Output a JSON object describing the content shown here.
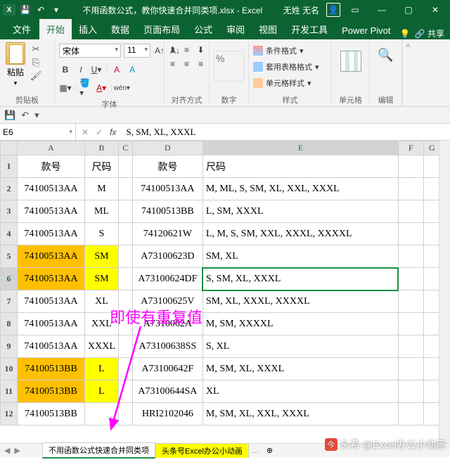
{
  "title": "不用函数公式，教你快速合并同类项.xlsx  -  Excel",
  "user": "无姓 无名",
  "tabs": {
    "file": "文件",
    "home": "开始",
    "insert": "插入",
    "data": "数据",
    "layout": "页面布局",
    "formulas": "公式",
    "review": "审阅",
    "view": "视图",
    "dev": "开发工具",
    "power": "Power Pivot"
  },
  "share": "共享",
  "ribbon": {
    "clipboard": {
      "paste": "粘贴",
      "label": "剪贴板"
    },
    "font": {
      "name": "宋体",
      "size": "11",
      "label": "字体"
    },
    "align": {
      "btn": "对齐方式",
      "label": ""
    },
    "number": {
      "btn": "数字",
      "label": ""
    },
    "styles": {
      "cond": "条件格式",
      "table": "套用表格格式",
      "cell": "单元格样式",
      "label": "样式"
    },
    "cells": {
      "btn": "单元格"
    },
    "edit": {
      "btn": "编辑"
    }
  },
  "namebox": "E6",
  "formula": "S, SM, XL, XXXL",
  "columns": {
    "A": "A",
    "B": "B",
    "C": "C",
    "D": "D",
    "E": "E",
    "F": "F",
    "G": "G"
  },
  "colwidths": {
    "A": 96,
    "B": 46,
    "C": 20,
    "D": 100,
    "E": 278,
    "F": 36,
    "G": 24
  },
  "headers": {
    "A": "款号",
    "B": "尺码",
    "D": "款号",
    "E": "尺码"
  },
  "rows": [
    {
      "n": 1
    },
    {
      "n": 2,
      "A": "74100513AA",
      "B": "M",
      "D": "74100513AA",
      "E": "M, ML, S, SM, XL, XXL, XXXL"
    },
    {
      "n": 3,
      "A": "74100513AA",
      "B": "ML",
      "D": "74100513BB",
      "E": "L, SM, XXXL"
    },
    {
      "n": 4,
      "A": "74100513AA",
      "B": "S",
      "D": "74120621W",
      "E": "L, M, S, SM, XXL, XXXL, XXXXL"
    },
    {
      "n": 5,
      "A": "74100513AA",
      "B": "SM",
      "D": "A73100623D",
      "E": "SM, XL",
      "hlA": "orange",
      "hlB": "yellow"
    },
    {
      "n": 6,
      "A": "74100513AA",
      "B": "SM",
      "D": "A73100624DF",
      "E": "S, SM, XL, XXXL",
      "hlA": "orange",
      "hlB": "yellow",
      "sel": true
    },
    {
      "n": 7,
      "A": "74100513AA",
      "B": "XL",
      "D": "A73100625V",
      "E": "SM, XL, XXXL, XXXXL"
    },
    {
      "n": 8,
      "A": "74100513AA",
      "B": "XXL",
      "D": "A7310062A",
      "E": "M, SM, XXXXL"
    },
    {
      "n": 9,
      "A": "74100513AA",
      "B": "XXXL",
      "D": "A73100638SS",
      "E": "S, XL"
    },
    {
      "n": 10,
      "A": "74100513BB",
      "B": "L",
      "D": "A73100642F",
      "E": "M, SM, XL, XXXL",
      "hlA": "orange",
      "hlB": "yellow"
    },
    {
      "n": 11,
      "A": "74100513BB",
      "B": "L",
      "D": "A73100644SA",
      "E": "XL",
      "hlA": "orange",
      "hlB": "yellow"
    },
    {
      "n": 12,
      "A": "74100513BB",
      "D": "HRI2102046",
      "E": "M, SM, XL, XXL, XXXL"
    }
  ],
  "annotation": "即使有重复值",
  "sheetTabs": {
    "t1": "不用函数公式快速合并同类项",
    "t2": "头条号Excel办公小动画"
  },
  "watermark": "头希 @Excel办公小动画"
}
